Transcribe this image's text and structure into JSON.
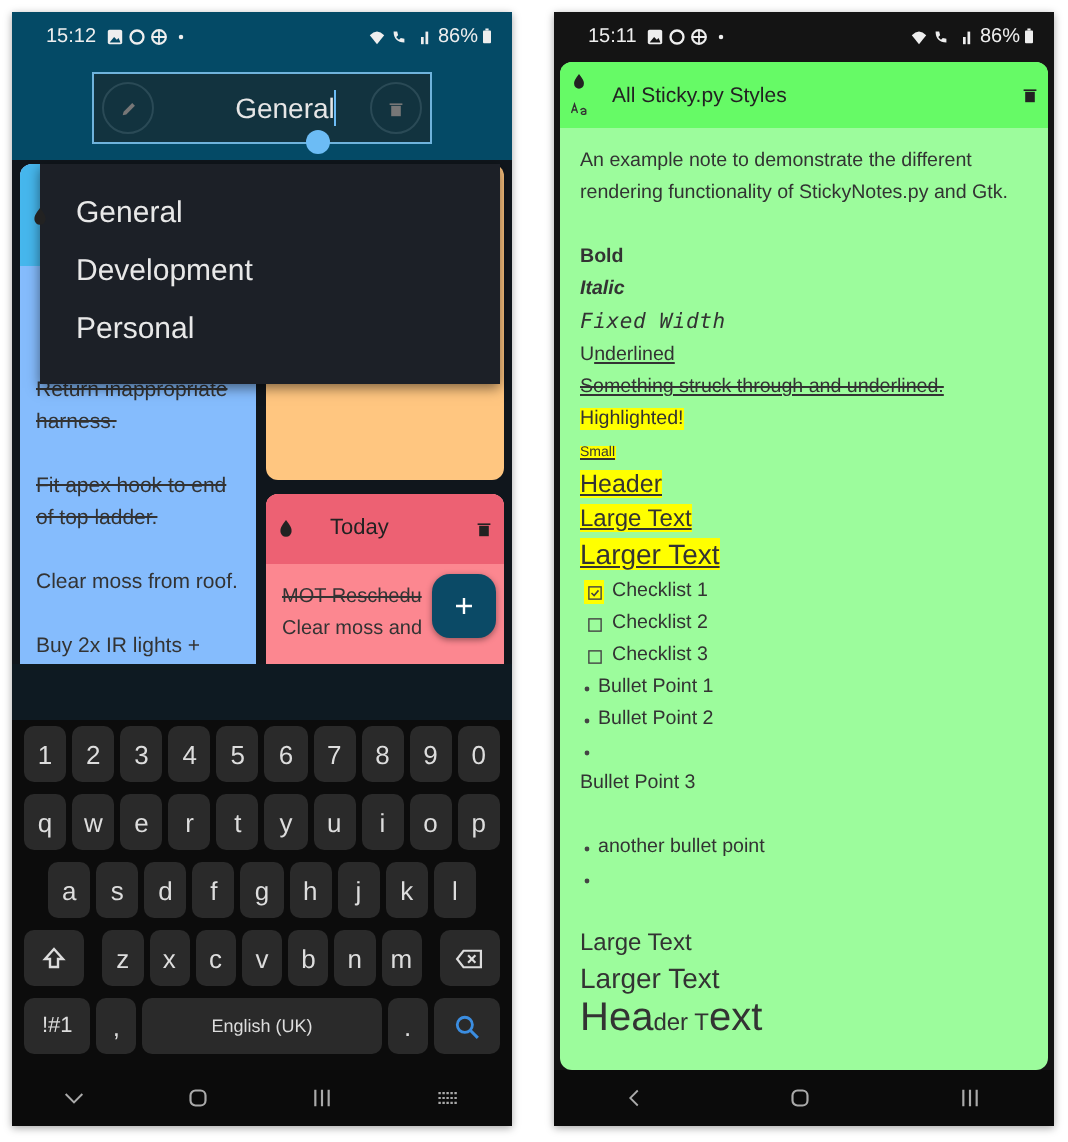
{
  "left_screen": {
    "status_bar": {
      "time": "15:12",
      "battery": "86%"
    },
    "category_field": {
      "value": "General"
    },
    "category_menu": [
      {
        "label": "General"
      },
      {
        "label": "Development"
      },
      {
        "label": "Personal"
      }
    ],
    "note_columns": [
      [
        {
          "color": "#85bcfd",
          "body": [
            {
              "text": "Return inappropriate harness.",
              "done": true
            },
            {
              "text": "Fit apex hook to end of top ladder.",
              "done": true
            },
            {
              "text": "Clear moss from roof.",
              "done": false
            },
            {
              "text": "Buy 2x IR lights +",
              "done": false
            }
          ]
        }
      ],
      [
        {
          "color": "#ffc680"
        },
        {
          "color": "#fc8790",
          "title": "Today",
          "body": [
            {
              "text": "MOT Reschedu",
              "done": true
            },
            {
              "text": "Clear moss and",
              "done": false
            }
          ]
        }
      ]
    ],
    "keyboard": {
      "rows": [
        [
          "1",
          "2",
          "3",
          "4",
          "5",
          "6",
          "7",
          "8",
          "9",
          "0"
        ],
        [
          "q",
          "w",
          "e",
          "r",
          "t",
          "y",
          "u",
          "i",
          "o",
          "p"
        ],
        [
          "a",
          "s",
          "d",
          "f",
          "g",
          "h",
          "j",
          "k",
          "l"
        ],
        [
          "z",
          "x",
          "c",
          "v",
          "b",
          "n",
          "m"
        ]
      ],
      "mode_key": "!#1",
      "comma_key": ",",
      "space_key": "English (UK)",
      "period_key": "."
    }
  },
  "right_screen": {
    "status_bar": {
      "time": "15:11",
      "battery": "86%"
    },
    "note": {
      "title": "All Sticky.py Styles",
      "color": "#66fa66",
      "lines": [
        {
          "kind": "text",
          "segments": [
            {
              "text": "An example note to demonstrate the different rendering functionality of StickyNotes.py and Gtk."
            }
          ]
        },
        {
          "kind": "blank"
        },
        {
          "kind": "text",
          "segments": [
            {
              "text": "Bold",
              "bold": true
            }
          ]
        },
        {
          "kind": "text",
          "segments": [
            {
              "text": "Italic",
              "bold": true,
              "italic": true
            }
          ]
        },
        {
          "kind": "text",
          "segments": [
            {
              "text": "Fixed Width",
              "kind": "mono",
              "italic": true
            }
          ]
        },
        {
          "kind": "text",
          "segments": [
            {
              "text": "U"
            },
            {
              "text": "nderlined",
              "underline": true
            }
          ]
        },
        {
          "kind": "text",
          "segments": [
            {
              "text": "Something struck through and underlined.",
              "strike": true,
              "underline": true
            }
          ]
        },
        {
          "kind": "text",
          "segments": [
            {
              "text": "Highlighted!",
              "highlight": true
            }
          ]
        },
        {
          "kind": "text",
          "segments": [
            {
              "text": "Small",
              "kind": "small",
              "underline": true,
              "highlight": true
            }
          ]
        },
        {
          "kind": "text",
          "segments": [
            {
              "text": "Header",
              "kind": "header",
              "underline": true,
              "highlight": true
            }
          ]
        },
        {
          "kind": "text",
          "segments": [
            {
              "text": "Large Text",
              "kind": "large",
              "underline": true,
              "highlight": true
            }
          ]
        },
        {
          "kind": "text",
          "segments": [
            {
              "text": "Larger Text",
              "kind": "larger",
              "underline": true,
              "highlight": true
            }
          ]
        },
        {
          "kind": "check",
          "checked": true,
          "highlighted": true,
          "text": "Checklist 1"
        },
        {
          "kind": "check",
          "checked": false,
          "highlighted": false,
          "text": "Checklist 2"
        },
        {
          "kind": "check",
          "checked": false,
          "highlighted": false,
          "text": "Checklist 3"
        },
        {
          "kind": "bullet",
          "text": "Bullet Point 1"
        },
        {
          "kind": "bullet",
          "text": "Bullet Point 2"
        },
        {
          "kind": "bullet"
        },
        {
          "kind": "text",
          "segments": [
            {
              "text": "Bullet Point 3"
            }
          ]
        },
        {
          "kind": "blank"
        },
        {
          "kind": "bullet",
          "text": "another bullet point"
        },
        {
          "kind": "bullet"
        },
        {
          "kind": "blank"
        },
        {
          "kind": "text",
          "segments": [
            {
              "text": "Large Text",
              "kind": "large"
            }
          ]
        },
        {
          "kind": "text",
          "segments": [
            {
              "text": "Larger Text",
              "kind": "larger"
            }
          ]
        },
        {
          "kind": "text",
          "segments": [
            {
              "text": "Hea",
              "kind": "huge"
            },
            {
              "text": "der T",
              "kind": "large"
            },
            {
              "text": "ext",
              "kind": "huge"
            }
          ]
        }
      ]
    }
  }
}
